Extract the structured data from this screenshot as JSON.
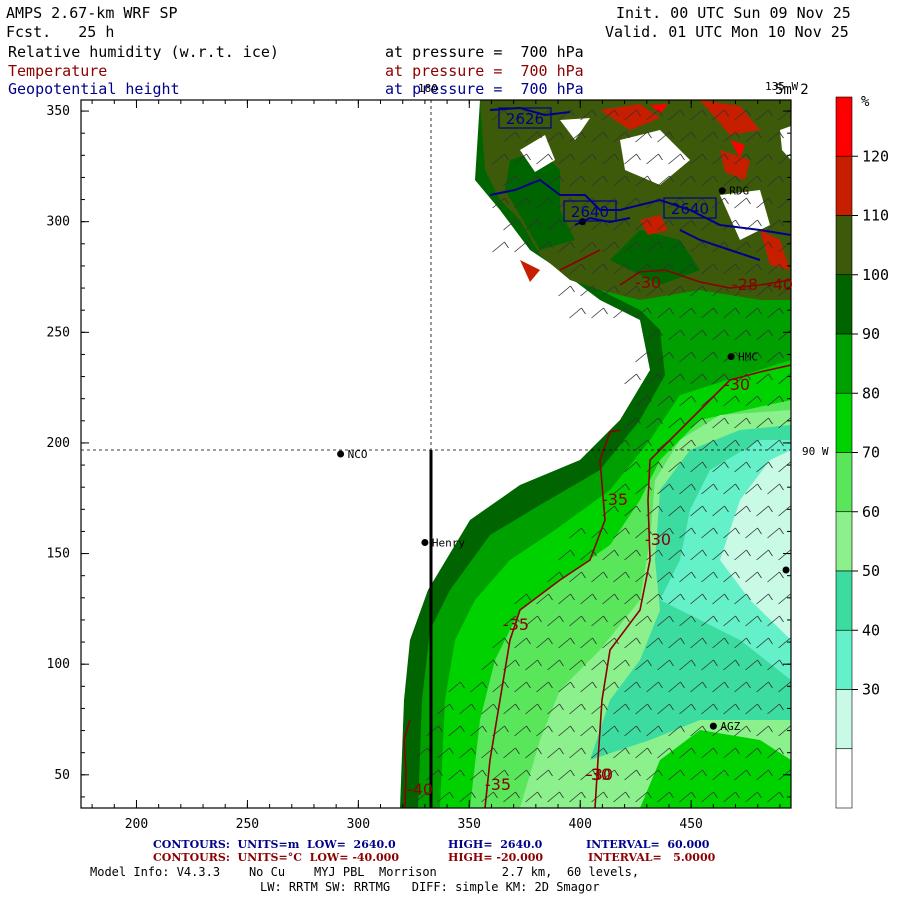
{
  "header": {
    "model": "AMPS 2.67-km WRF SP",
    "fcst": "Fcst.   25 h",
    "init": "Init. 00 UTC Sun 09 Nov 25",
    "valid": "Valid. 01 UTC Mon 10 Nov 25",
    "field1": "Relative humidity (w.r.t. ice)",
    "field2": "Temperature",
    "field3": "Geopotential height",
    "level1": "at pressure =  700 hPa",
    "level2": "at pressure =  700 hPa",
    "level3": "at pressure =  700 hPa"
  },
  "map": {
    "x_ticks": [
      "200",
      "250",
      "300",
      "350",
      "400",
      "450"
    ],
    "y_ticks": [
      "350",
      "300",
      "250",
      "200",
      "150",
      "100",
      "50"
    ],
    "meridian_labels": {
      "m180": "180",
      "m135w": "135 W",
      "m90w": "90 W"
    },
    "wind_ref": "5m 2",
    "stations": [
      {
        "name": "NCO",
        "x": 292,
        "y": 195
      },
      {
        "name": "Henry",
        "x": 330,
        "y": 155
      },
      {
        "name": "AGZ",
        "x": 460,
        "y": 72
      },
      {
        "name": "HMC",
        "x": 468,
        "y": 239
      },
      {
        "name": "RDG",
        "x": 464,
        "y": 314
      },
      {
        "name": "",
        "x": 401,
        "y": 300
      }
    ],
    "height_labels": [
      "2626",
      "2640",
      "2640"
    ],
    "temp_labels": [
      "-35",
      "-30",
      "-35",
      "-30",
      "-35",
      "-30",
      "-40",
      "-30",
      "-28",
      "-40",
      "-30"
    ],
    "colors": {
      "low_humidity": "#ffffff",
      "high_humidity": "#ff0000",
      "temp_contour": "#8b0000",
      "height_contour": "#00008b"
    }
  },
  "colorbar": {
    "unit": "%",
    "labels": [
      "120",
      "110",
      "100",
      "90",
      "80",
      "70",
      "60",
      "50",
      "40",
      "30"
    ],
    "colors": [
      "#ff0000",
      "#c81e00",
      "#3c5a0a",
      "#006400",
      "#00a000",
      "#00d200",
      "#5ae65a",
      "#8cf08c",
      "#3cdca0",
      "#64f0c8",
      "#c8fae6",
      "#ffffff"
    ]
  },
  "footer": {
    "line1a": "CONTOURS:  UNITS=m  LOW=  2640.0",
    "line1b": "HIGH=  2640.0",
    "line1c": "INTERVAL=  60.000",
    "line2a": "CONTOURS:  UNITS=°C  LOW= -40.000",
    "line2b": "HIGH= -20.000",
    "line2c": "INTERVAL=   5.0000",
    "line3": "Model Info: V4.3.3    No Cu    MYJ PBL  Morrison         2.7 km,  60 levels,",
    "line4": "LW: RRTM SW: RRTMG   DIFF: simple KM: 2D Smagor"
  }
}
